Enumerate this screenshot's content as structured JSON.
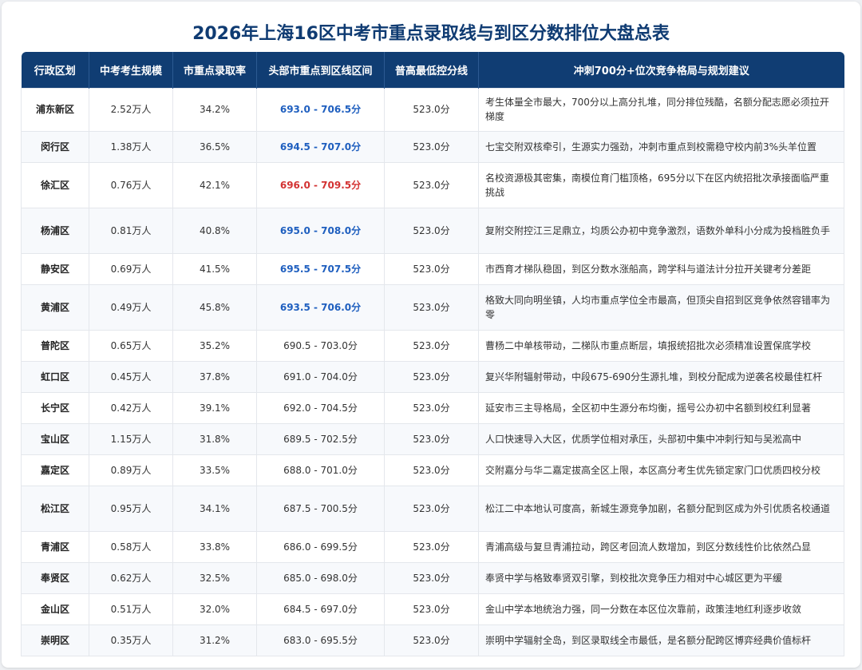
{
  "title": "2026年上海16区中考市重点录取线与到区分数排位大盘总表",
  "columns": [
    "行政区划",
    "中考考生规模",
    "市重点录取率",
    "头部市重点到区线区间",
    "普高最低控分线",
    "冲刺700分+位次竞争格局与规划建议"
  ],
  "highlight_colors": {
    "blue": "#1f5fbf",
    "red": "#d33333",
    "header_bg": "#103d73"
  },
  "rows": [
    {
      "district": "浦东新区",
      "scale": "2.52万人",
      "rate": "34.2%",
      "range": "693.0 - 706.5分",
      "range_style": "blue",
      "min_line": "523.0分",
      "advice": "考生体量全市最大，700分以上高分扎堆，同分排位残酷，名额分配志愿必须拉开梯度",
      "height": 54
    },
    {
      "district": "闵行区",
      "scale": "1.38万人",
      "rate": "36.5%",
      "range": "694.5 - 707.0分",
      "range_style": "blue",
      "min_line": "523.0分",
      "advice": "七宝交附双核牵引，生源实力强劲，冲刺市重点到校需稳守校内前3%头羊位置",
      "height": 39
    },
    {
      "district": "徐汇区",
      "scale": "0.76万人",
      "rate": "42.1%",
      "range": "696.0 - 709.5分",
      "range_style": "red",
      "min_line": "523.0分",
      "advice": "名校资源极其密集，南模位育门槛顶格，695分以下在区内统招批次承接面临严重挑战",
      "height": 57
    },
    {
      "district": "杨浦区",
      "scale": "0.81万人",
      "rate": "40.8%",
      "range": "695.0 - 708.0分",
      "range_style": "blue",
      "min_line": "523.0分",
      "advice": "复附交附控江三足鼎立，均质公办初中竞争激烈，语数外单科小分成为投档胜负手",
      "height": 57
    },
    {
      "district": "静安区",
      "scale": "0.69万人",
      "rate": "41.5%",
      "range": "695.5 - 707.5分",
      "range_style": "blue",
      "min_line": "523.0分",
      "advice": "市西育才梯队稳固，到区分数水涨船高，跨学科与道法计分拉开关键考分差距",
      "height": 39
    },
    {
      "district": "黄浦区",
      "scale": "0.49万人",
      "rate": "45.8%",
      "range": "693.5 - 706.0分",
      "range_style": "blue",
      "min_line": "523.0分",
      "advice": "格致大同向明坐镇，人均市重点学位全市最高，但顶尖自招到区竞争依然容错率为零",
      "height": 57
    },
    {
      "district": "普陀区",
      "scale": "0.65万人",
      "rate": "35.2%",
      "range": "690.5 - 703.0分",
      "range_style": "normal",
      "min_line": "523.0分",
      "advice": "曹杨二中单核带动，二梯队市重点断层，填报统招批次必须精准设置保底学校",
      "height": 39
    },
    {
      "district": "虹口区",
      "scale": "0.45万人",
      "rate": "37.8%",
      "range": "691.0 - 704.0分",
      "range_style": "normal",
      "min_line": "523.0分",
      "advice": "复兴华附辐射带动，中段675-690分生源扎堆，到校分配成为逆袭名校最佳杠杆",
      "height": 39
    },
    {
      "district": "长宁区",
      "scale": "0.42万人",
      "rate": "39.1%",
      "range": "692.0 - 704.5分",
      "range_style": "normal",
      "min_line": "523.0分",
      "advice": "延安市三主导格局，全区初中生源分布均衡，摇号公办初中名额到校红利显著",
      "height": 39
    },
    {
      "district": "宝山区",
      "scale": "1.15万人",
      "rate": "31.8%",
      "range": "689.5 - 702.5分",
      "range_style": "normal",
      "min_line": "523.0分",
      "advice": "人口快速导入大区，优质学位相对承压，头部初中集中冲刺行知与吴淞高中",
      "height": 39
    },
    {
      "district": "嘉定区",
      "scale": "0.89万人",
      "rate": "33.5%",
      "range": "688.0 - 701.0分",
      "range_style": "normal",
      "min_line": "523.0分",
      "advice": "交附嘉分与华二嘉定拔高全区上限，本区高分考生优先锁定家门口优质四校分校",
      "height": 39
    },
    {
      "district": "松江区",
      "scale": "0.95万人",
      "rate": "34.1%",
      "range": "687.5 - 700.5分",
      "range_style": "normal",
      "min_line": "523.0分",
      "advice": "松江二中本地认可度高，新城生源竞争加剧，名额分配到区成为外引优质名校通道",
      "height": 57
    },
    {
      "district": "青浦区",
      "scale": "0.58万人",
      "rate": "33.8%",
      "range": "686.0 - 699.5分",
      "range_style": "normal",
      "min_line": "523.0分",
      "advice": "青浦高级与复旦青浦拉动，跨区考回流人数增加，到区分数线性价比依然凸显",
      "height": 39
    },
    {
      "district": "奉贤区",
      "scale": "0.62万人",
      "rate": "32.5%",
      "range": "685.0 - 698.0分",
      "range_style": "normal",
      "min_line": "523.0分",
      "advice": "奉贤中学与格致奉贤双引擎，到校批次竞争压力相对中心城区更为平缓",
      "height": 39
    },
    {
      "district": "金山区",
      "scale": "0.51万人",
      "rate": "32.0%",
      "range": "684.5 - 697.0分",
      "range_style": "normal",
      "min_line": "523.0分",
      "advice": "金山中学本地统治力强，同一分数在本区位次靠前，政策洼地红利逐步收敛",
      "height": 39
    },
    {
      "district": "崇明区",
      "scale": "0.35万人",
      "rate": "31.2%",
      "range": "683.0 - 695.5分",
      "range_style": "normal",
      "min_line": "523.0分",
      "advice": "崇明中学辐射全岛，到区录取线全市最低，是名额分配跨区博弈经典价值标杆",
      "height": 39
    }
  ]
}
